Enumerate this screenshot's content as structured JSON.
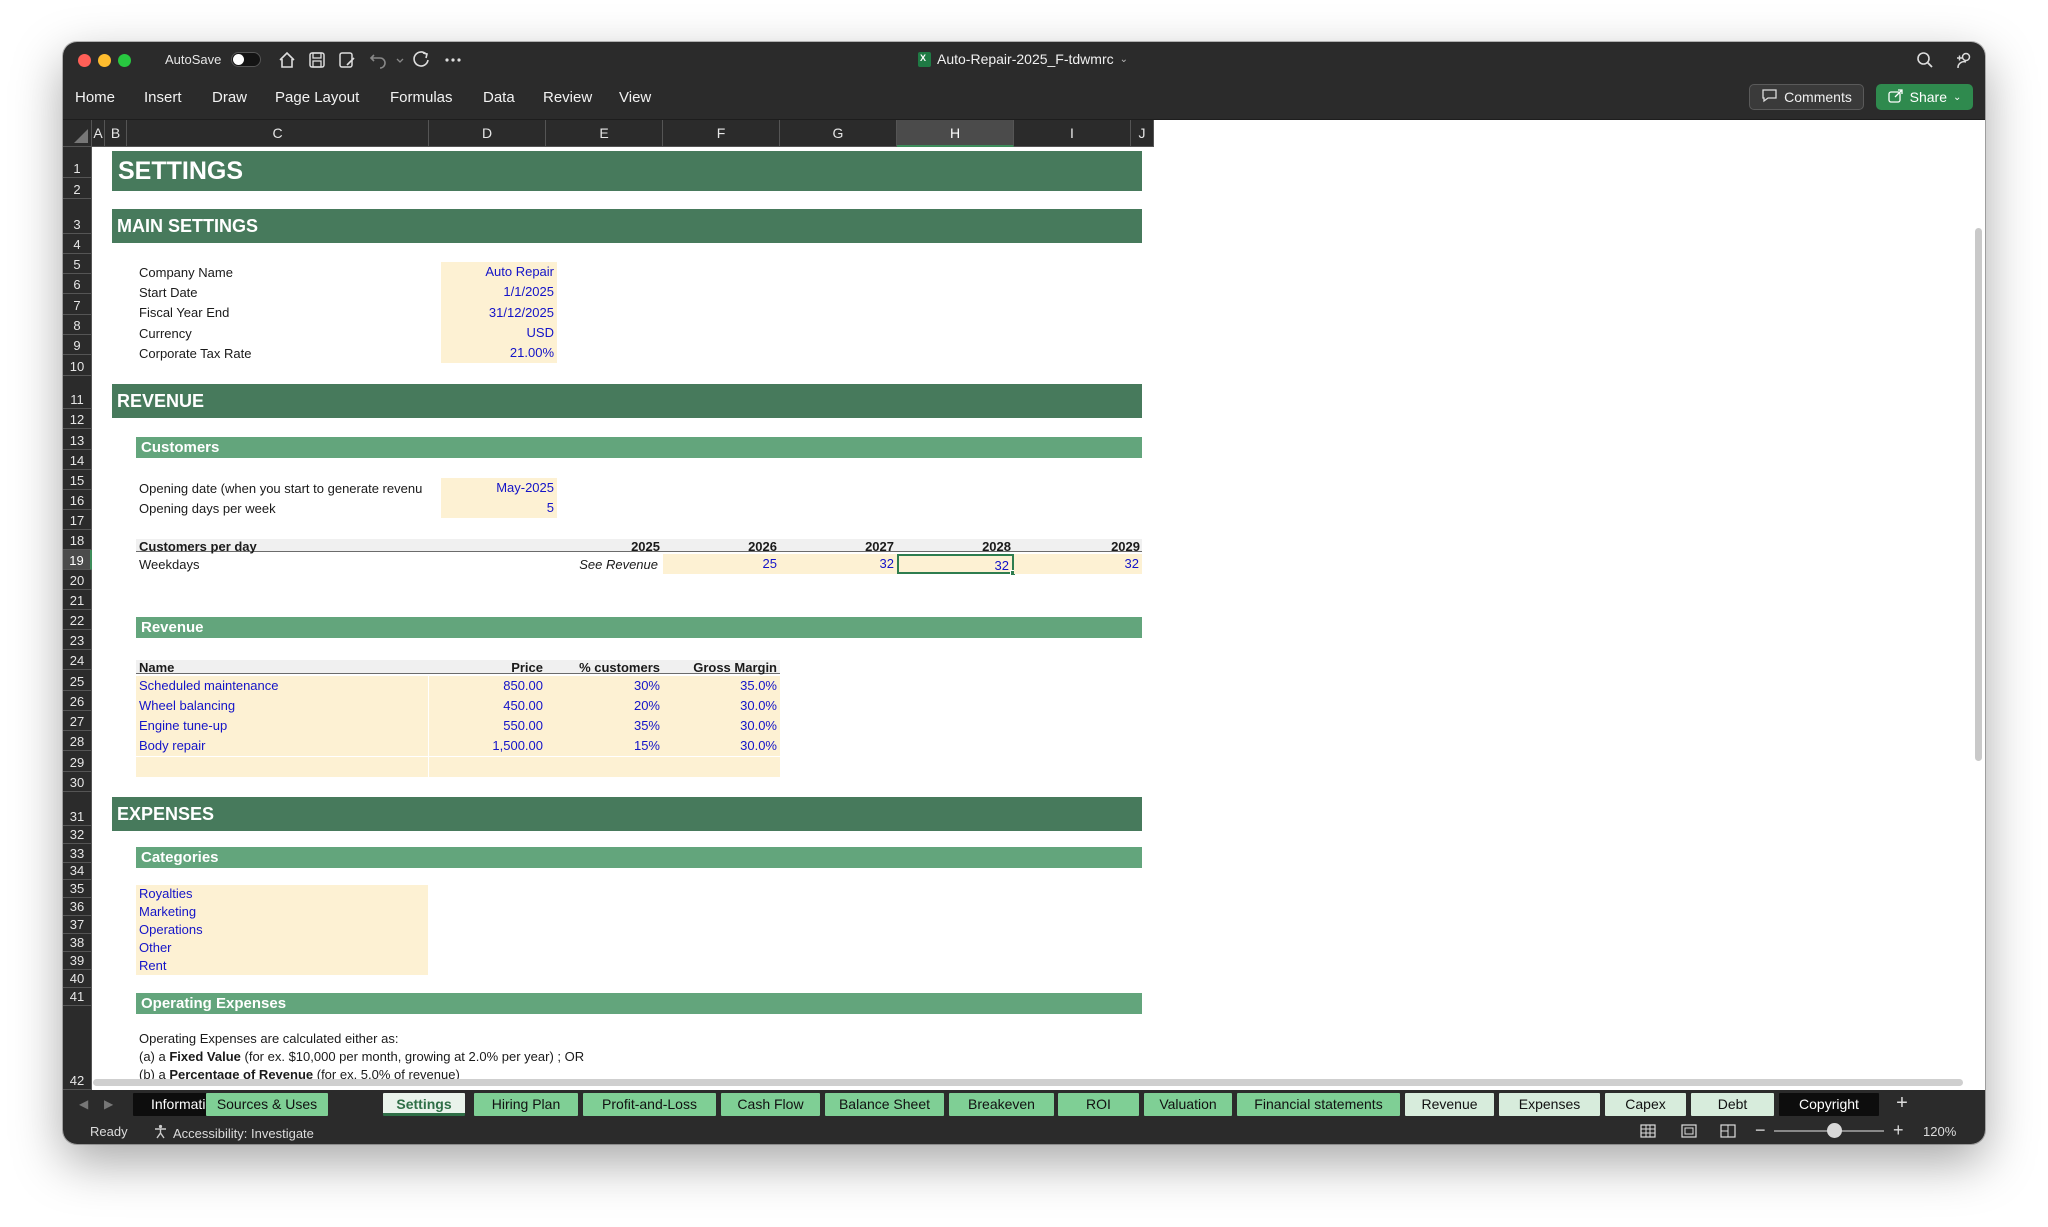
{
  "window": {
    "autosave_label": "AutoSave",
    "document_title": "Auto-Repair-2025_F-tdwmrc",
    "menu": [
      "Home",
      "Insert",
      "Draw",
      "Page Layout",
      "Formulas",
      "Data",
      "Review",
      "View"
    ],
    "comments_label": "Comments",
    "share_label": "Share",
    "toolbar_icons": [
      "home-icon",
      "save-icon",
      "save-as-icon",
      "undo-icon",
      "redo-icon",
      "more-icon"
    ],
    "colors": {
      "header_band": "#477a5c",
      "sub_band": "#63a57c",
      "input_fill": "#fdf1d3",
      "input_text": "#1414c8"
    }
  },
  "grid": {
    "columns": [
      "A",
      "B",
      "C",
      "D",
      "E",
      "F",
      "G",
      "H",
      "I",
      "J"
    ],
    "selected_column": "H",
    "selected_row": "19",
    "rows": [
      "1",
      "2",
      "3",
      "4",
      "5",
      "6",
      "7",
      "8",
      "9",
      "10",
      "11",
      "12",
      "13",
      "14",
      "15",
      "16",
      "17",
      "18",
      "19",
      "20",
      "21",
      "22",
      "23",
      "24",
      "25",
      "26",
      "27",
      "28",
      "29",
      "30",
      "31",
      "32",
      "33",
      "34",
      "35",
      "36",
      "37",
      "38",
      "39",
      "40",
      "41",
      "42"
    ]
  },
  "sheet": {
    "title": "SETTINGS",
    "main_settings": {
      "header": "MAIN SETTINGS",
      "fields": [
        {
          "label": "Company Name",
          "value": "Auto Repair"
        },
        {
          "label": "Start Date",
          "value": "1/1/2025"
        },
        {
          "label": "Fiscal Year End",
          "value": "31/12/2025"
        },
        {
          "label": "Currency",
          "value": "USD"
        },
        {
          "label": "Corporate Tax Rate",
          "value": "21.00%"
        }
      ]
    },
    "revenue_section": {
      "header": "REVENUE",
      "customers": {
        "header": "Customers",
        "opening_date_label": "Opening date (when you start to generate revenu",
        "opening_date_value": "May-2025",
        "opening_days_label": "Opening days per week",
        "opening_days_value": "5",
        "table_label": "Customers per day",
        "years": [
          "2025",
          "2026",
          "2027",
          "2028",
          "2029"
        ],
        "weekdays_label": "Weekdays",
        "weekdays_values": [
          "See Revenue",
          "25",
          "32",
          "32",
          "32"
        ]
      },
      "revenue": {
        "header": "Revenue",
        "columns": [
          "Name",
          "Price",
          "% customers",
          "Gross Margin"
        ],
        "rows": [
          [
            "Scheduled maintenance",
            "850.00",
            "30%",
            "35.0%"
          ],
          [
            "Wheel balancing",
            "450.00",
            "20%",
            "30.0%"
          ],
          [
            "Engine tune-up",
            "550.00",
            "35%",
            "30.0%"
          ],
          [
            "Body repair",
            "1,500.00",
            "15%",
            "30.0%"
          ]
        ]
      }
    },
    "expenses_section": {
      "header": "EXPENSES",
      "categories_header": "Categories",
      "categories": [
        "Royalties",
        "Marketing",
        "Operations",
        "Other",
        "Rent"
      ],
      "opex_header": "Operating Expenses",
      "opex_line1": "Operating Expenses are calculated either as:",
      "opex_line2_prefix": "(a) a ",
      "opex_line2_bold": "Fixed Value",
      "opex_line2_suffix": " (for ex. $10,000 per month, growing at 2.0% per year) ; OR",
      "opex_line3_prefix": "(b) a ",
      "opex_line3_bold": "Percentage of Revenue",
      "opex_line3_suffix": " (for ex. 5.0% of revenue)"
    }
  },
  "tabs": [
    {
      "label": "Information",
      "style": "black"
    },
    {
      "label": "Sources & Uses",
      "style": "green"
    },
    {
      "label": "Settings",
      "style": "active"
    },
    {
      "label": "Hiring Plan",
      "style": "green"
    },
    {
      "label": "Profit-and-Loss",
      "style": "green"
    },
    {
      "label": "Cash Flow",
      "style": "green"
    },
    {
      "label": "Balance Sheet",
      "style": "green"
    },
    {
      "label": "Breakeven",
      "style": "green"
    },
    {
      "label": "ROI",
      "style": "green"
    },
    {
      "label": "Valuation",
      "style": "green"
    },
    {
      "label": "Financial statements",
      "style": "green"
    },
    {
      "label": "Revenue",
      "style": "light"
    },
    {
      "label": "Expenses",
      "style": "light"
    },
    {
      "label": "Capex",
      "style": "light"
    },
    {
      "label": "Debt",
      "style": "light"
    },
    {
      "label": "Copyright",
      "style": "black"
    }
  ],
  "status": {
    "ready": "Ready",
    "accessibility": "Accessibility: Investigate",
    "zoom": "120%",
    "zoom_level": 0.5
  }
}
